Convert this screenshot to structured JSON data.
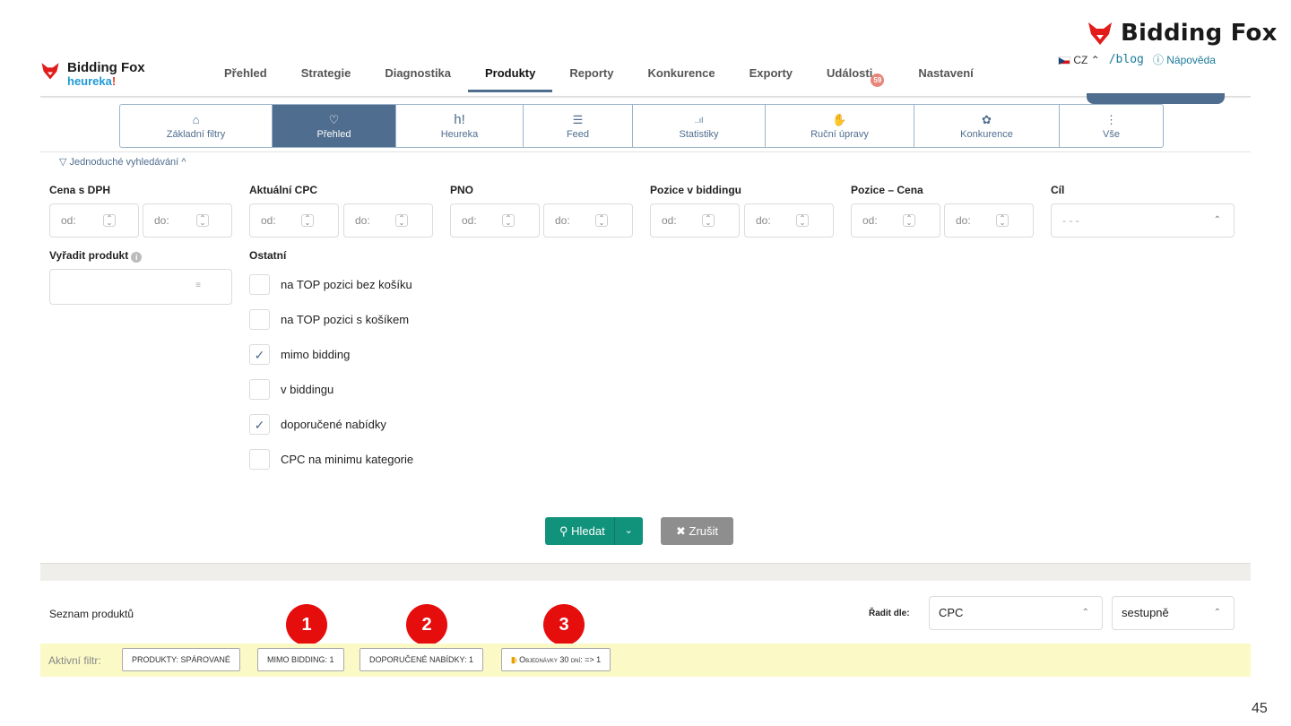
{
  "brand": {
    "name": "Bidding Fox",
    "sub_prefix": "heurek",
    "sub_suffix": "a",
    "sub_bang": "!"
  },
  "util": {
    "lang": "CZ",
    "blog": "/blog",
    "help": "Nápověda"
  },
  "nav": {
    "items": [
      "Přehled",
      "Strategie",
      "Diagnostika",
      "Produkty",
      "Reporty",
      "Konkurence",
      "Exporty",
      "Události",
      "Nastavení"
    ],
    "active": "Produkty",
    "events_badge": "59"
  },
  "subtabs": [
    {
      "label": "Základní filtry",
      "icon": "⌂"
    },
    {
      "label": "Přehled",
      "icon": "♡"
    },
    {
      "label": "Heureka",
      "icon": "h!"
    },
    {
      "label": "Feed",
      "icon": "☰"
    },
    {
      "label": "Statistiky",
      "icon": "..ıl"
    },
    {
      "label": "Ruční úpravy",
      "icon": "✋"
    },
    {
      "label": "Konkurence",
      "icon": "✿"
    },
    {
      "label": "Vše",
      "icon": "⋮"
    }
  ],
  "simple_search": "Jednoduché vyhledávání",
  "filters": {
    "price": "Cena s DPH",
    "cpc": "Aktuální CPC",
    "pno": "PNO",
    "position": "Pozice v biddingu",
    "pos_price": "Pozice – Cena",
    "goal": "Cíl",
    "from": "od:",
    "to": "do:",
    "goal_placeholder": "- - -",
    "exclude": "Vyřadit produkt",
    "other": "Ostatní"
  },
  "checks": [
    {
      "label": "na TOP pozici bez košíku",
      "checked": false
    },
    {
      "label": "na TOP pozici s košíkem",
      "checked": false
    },
    {
      "label": "mimo bidding",
      "checked": true
    },
    {
      "label": "v biddingu",
      "checked": false
    },
    {
      "label": "doporučené nabídky",
      "checked": true
    },
    {
      "label": "CPC na minimu kategorie",
      "checked": false
    }
  ],
  "buttons": {
    "search": "Hledat",
    "cancel": "Zrušit"
  },
  "list": {
    "title": "Seznam produktů",
    "sort_label": "Řadit dle:",
    "sort_by": "CPC",
    "sort_dir": "sestupně"
  },
  "active_filter": {
    "label": "Aktivní filtr:",
    "chips": [
      "PRODUKTY: SPÁROVANÉ",
      "MIMO BIDDING: 1",
      "DOPORUČENÉ NABÍDKY: 1",
      "Objednávky 30 dní: => 1"
    ]
  },
  "markers": [
    "1",
    "2",
    "3"
  ],
  "page_number": "45",
  "colors": {
    "accent": "#4f6d8f",
    "search": "#11927b",
    "marker": "#e60d0d",
    "bar": "#fbfac7"
  }
}
